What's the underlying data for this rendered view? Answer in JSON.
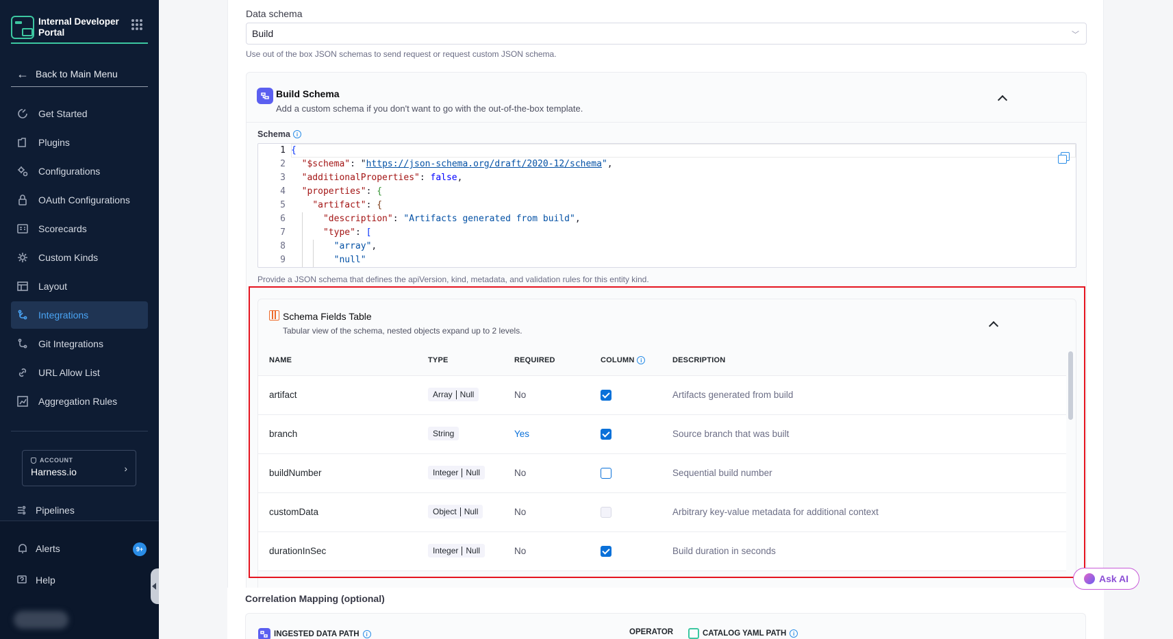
{
  "sidebar": {
    "brand_title": "Internal Developer Portal",
    "back_label": "Back to Main Menu",
    "items": [
      {
        "label": "Get Started",
        "icon": "rocket-icon"
      },
      {
        "label": "Plugins",
        "icon": "plugin-icon"
      },
      {
        "label": "Configurations",
        "icon": "gear-icon"
      },
      {
        "label": "OAuth Configurations",
        "icon": "lock-icon"
      },
      {
        "label": "Scorecards",
        "icon": "scorecard-icon"
      },
      {
        "label": "Custom Kinds",
        "icon": "gear-icon"
      },
      {
        "label": "Layout",
        "icon": "layout-icon"
      },
      {
        "label": "Integrations",
        "icon": "integration-icon",
        "active": true
      },
      {
        "label": "Git Integrations",
        "icon": "git-icon"
      },
      {
        "label": "URL Allow List",
        "icon": "link-icon"
      },
      {
        "label": "Aggregation Rules",
        "icon": "chart-icon"
      }
    ],
    "account_label": "ACCOUNT",
    "account_name": "Harness.io",
    "pipelines_label": "Pipelines",
    "alerts_label": "Alerts",
    "alerts_badge": "9+",
    "help_label": "Help"
  },
  "form": {
    "data_schema_label": "Data schema",
    "data_schema_value": "Build",
    "data_schema_help": "Use out of the box JSON schemas to send request or request custom JSON schema.",
    "build_schema_title": "Build Schema",
    "build_schema_subtitle": "Add a custom schema if you don't want to go with the out-of-the-box template.",
    "schema_label": "Schema",
    "schema_help": "Provide a JSON schema that defines the apiVersion, kind, metadata, and validation rules for this entity kind."
  },
  "code": {
    "line_numbers": [
      "1",
      "2",
      "3",
      "4",
      "5",
      "6",
      "7",
      "8",
      "9"
    ],
    "schema_key": "\"$schema\"",
    "schema_url": "https://json-schema.org/draft/2020-12/schema",
    "additional_key": "\"additionalProperties\"",
    "additional_value": "false",
    "properties_key": "\"properties\"",
    "artifact_key": "\"artifact\"",
    "description_key": "\"description\"",
    "description_value": "\"Artifacts generated from build\"",
    "type_key": "\"type\"",
    "array_value": "\"array\"",
    "null_value": "\"null\""
  },
  "fields_table": {
    "title": "Schema Fields Table",
    "subtitle": "Tabular view of the schema, nested objects expand up to 2 levels.",
    "columns": [
      "NAME",
      "TYPE",
      "REQUIRED",
      "COLUMN",
      "DESCRIPTION"
    ],
    "rows": [
      {
        "name": "artifact",
        "type": [
          "Array",
          "Null"
        ],
        "required": "No",
        "column": "checked",
        "description": "Artifacts generated from build"
      },
      {
        "name": "branch",
        "type": [
          "String"
        ],
        "required": "Yes",
        "column": "checked",
        "description": "Source branch that was built"
      },
      {
        "name": "buildNumber",
        "type": [
          "Integer",
          "Null"
        ],
        "required": "No",
        "column": "unchecked",
        "description": "Sequential build number"
      },
      {
        "name": "customData",
        "type": [
          "Object",
          "Null"
        ],
        "required": "No",
        "column": "disabled",
        "description": "Arbitrary key-value metadata for additional context"
      },
      {
        "name": "durationInSec",
        "type": [
          "Integer",
          "Null"
        ],
        "required": "No",
        "column": "checked",
        "description": "Build duration in seconds"
      }
    ]
  },
  "correlation": {
    "title": "Correlation Mapping (optional)",
    "col_ingested": "INGESTED DATA PATH",
    "col_operator": "OPERATOR",
    "col_catalog": "CATALOG YAML PATH"
  },
  "ask_ai_label": "Ask AI",
  "colors": {
    "sidebar_bg": "#0e1c33",
    "accent": "#0b71d9",
    "brand": "#3dc7a1",
    "highlight": "#e5141f"
  }
}
